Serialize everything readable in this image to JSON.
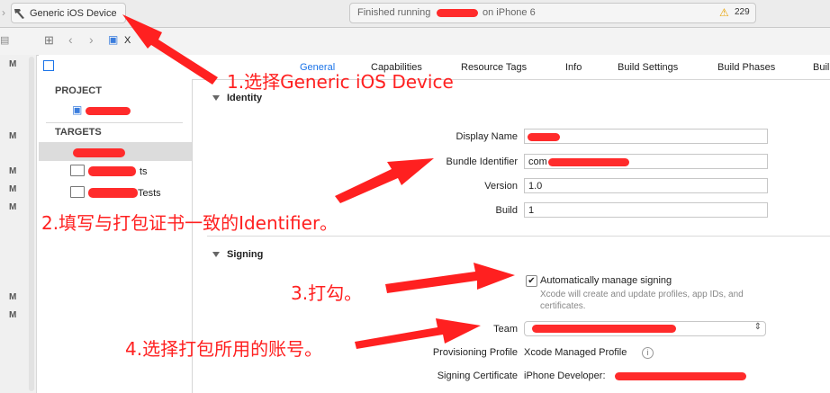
{
  "toolbar": {
    "scheme_label": "Generic iOS Device",
    "status_prefix": "Finished running",
    "status_suffix": "on iPhone 6",
    "warning_count": "229"
  },
  "navbar": {
    "file_label": "X"
  },
  "gutter": {
    "marks": [
      "M",
      "M",
      "M",
      "M",
      "M",
      "M",
      "M"
    ]
  },
  "tabs": [
    "General",
    "Capabilities",
    "Resource Tags",
    "Info",
    "Build Settings",
    "Build Phases",
    "Buil"
  ],
  "sidebar": {
    "project_header": "PROJECT",
    "targets_header": "TARGETS",
    "target_suffix_1": "ts",
    "target_suffix_2": "Tests"
  },
  "identity": {
    "title": "Identity",
    "display_name_label": "Display Name",
    "bundle_id_label": "Bundle Identifier",
    "bundle_id_value": "com",
    "version_label": "Version",
    "version_value": "1.0",
    "build_label": "Build",
    "build_value": "1"
  },
  "signing": {
    "title": "Signing",
    "auto_label": "Automatically manage signing",
    "auto_desc_1": "Xcode will create and update profiles, app IDs, and",
    "auto_desc_2": "certificates.",
    "team_label": "Team",
    "profile_label": "Provisioning Profile",
    "profile_value": "Xcode Managed Profile",
    "cert_label": "Signing Certificate",
    "cert_value": "iPhone Developer:"
  },
  "annotations": {
    "step1": "1.选择Generic iOS Device",
    "step2": "2.填写与打包证书一致的Identifier。",
    "step3": "3.打勾。",
    "step4": "4.选择打包所用的账号。"
  },
  "colors": {
    "annotation_red": "#ff2020",
    "accent_blue": "#1a73e8"
  }
}
